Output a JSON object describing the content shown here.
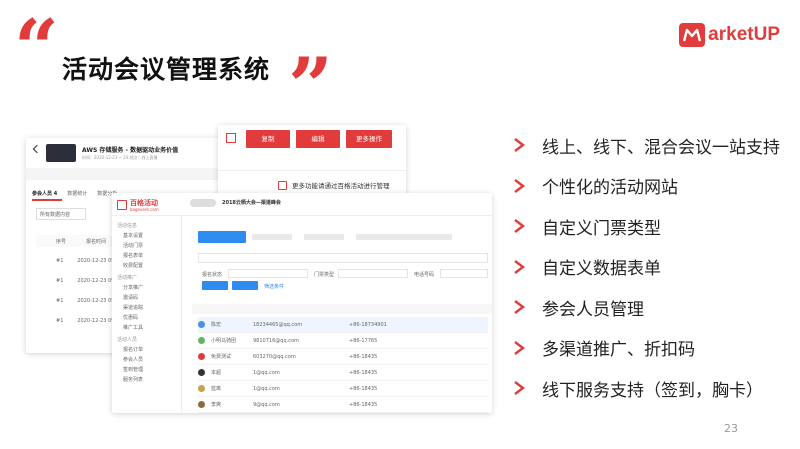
{
  "header": {
    "quote_open": "“",
    "quote_close": "”",
    "title": "活动会议管理系统",
    "brand": "arketUP",
    "brand_color": "#e23b3b"
  },
  "features": [
    "线上、线下、混合会议一站支持",
    "个性化的活动网站",
    "自定义门票类型",
    "自定义数据表单",
    "参会人员管理",
    "多渠道推广、折扣码",
    "线下服务支持（签到，胸卡）"
  ],
  "page_number": "23",
  "screenshot": {
    "back_panel": {
      "event_title": "AWS 存储服务 - 数据驱动业务价值",
      "event_meta": "时间：2020-12-23 ~ 24   地点：线上直播",
      "tabs": [
        "参会人员 4",
        "数据统计",
        "数据分析"
      ],
      "filter": "所有数据内容",
      "col_no": "序号",
      "col_time": "报名时间",
      "rows": [
        {
          "no": "#1",
          "time": "2020-12-23 09:"
        },
        {
          "no": "#1",
          "time": "2020-12-23 09:"
        },
        {
          "no": "#1",
          "time": "2020-12-23 09:"
        },
        {
          "no": "#1",
          "time": "2020-12-23 09:"
        }
      ]
    },
    "top_panel": {
      "buttons": [
        "复制",
        "编辑",
        "更多操作"
      ],
      "notice": "更多功能请通过百格活动进行管理"
    },
    "main_panel": {
      "logo": "百格活动",
      "logo_sub": "bagevent.com",
      "event_title": "2018云栖大会—渠道峰会",
      "side_sections": [
        {
          "heading": "活动信息",
          "items": [
            "基本设置",
            "活动门票",
            "报名表单",
            "收费配置"
          ]
        },
        {
          "heading": "活动推广",
          "items": [
            "分享推广",
            "邀请码",
            "渠道追踪",
            "优惠码",
            "推广工具"
          ]
        },
        {
          "heading": "活动人员",
          "items": [
            "报名订单",
            "参会人员",
            "签到管理",
            "服务列表"
          ]
        }
      ],
      "filter_labels": [
        "报名状态",
        "门票类型",
        "电话号码"
      ],
      "filter_placeholder": "筛选条件",
      "rows": [
        {
          "name": "陈宏",
          "email": "18234465@qq.com",
          "phone": "+86-18734901"
        },
        {
          "name": "小明马骑团",
          "email": "9810716@qq.com",
          "phone": "+86-17765"
        },
        {
          "name": "免费测试",
          "email": "603270@qq.com",
          "phone": "+86-18435"
        },
        {
          "name": "本超",
          "email": "1@qq.com",
          "phone": "+86-18435"
        },
        {
          "name": "蓝离",
          "email": "1@qq.com",
          "phone": "+86-18435"
        },
        {
          "name": "李爽",
          "email": "9@qq.com",
          "phone": "+86-18435"
        }
      ]
    }
  }
}
